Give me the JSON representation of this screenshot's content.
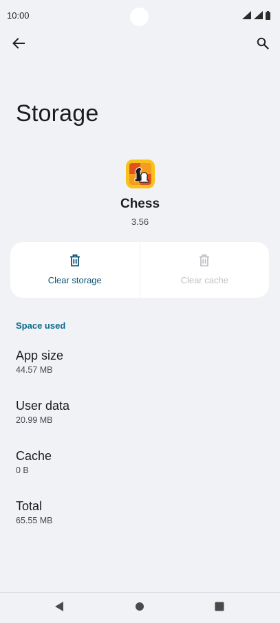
{
  "status_bar": {
    "time": "10:00",
    "icons": [
      "wifi-icon",
      "signal-icon",
      "battery-icon"
    ]
  },
  "app_bar": {
    "back_icon": "arrow-back-icon",
    "search_icon": "search-icon"
  },
  "page": {
    "title": "Storage"
  },
  "app": {
    "name": "Chess",
    "version": "3.56",
    "icon": "chess-app-icon"
  },
  "actions": {
    "clear_storage": {
      "label": "Clear storage",
      "icon": "trash-icon",
      "enabled": true
    },
    "clear_cache": {
      "label": "Clear cache",
      "icon": "trash-icon",
      "enabled": false
    }
  },
  "space_used": {
    "header": "Space used",
    "items": [
      {
        "label": "App size",
        "value": "44.57 MB"
      },
      {
        "label": "User data",
        "value": "20.99 MB"
      },
      {
        "label": "Cache",
        "value": "0 B"
      },
      {
        "label": "Total",
        "value": "65.55 MB"
      }
    ]
  },
  "nav_bar": {
    "buttons": [
      "nav-back-icon",
      "nav-home-icon",
      "nav-recents-icon"
    ]
  },
  "colors": {
    "background": "#f1f2f5",
    "card": "#ffffff",
    "accent": "#0a6a8c",
    "action_enabled": "#0d5372",
    "action_disabled": "#bfc1c6"
  }
}
